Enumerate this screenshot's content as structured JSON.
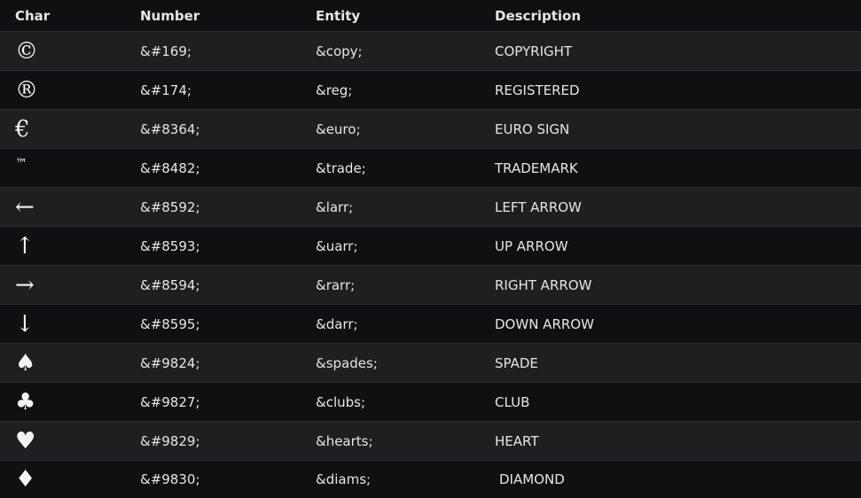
{
  "table": {
    "headers": [
      "Char",
      "Number",
      "Entity",
      "Description"
    ],
    "rows": [
      {
        "char": "©",
        "number": "&#169;",
        "entity": "&copy;",
        "description": "COPYRIGHT"
      },
      {
        "char": "®",
        "number": "&#174;",
        "entity": "&reg;",
        "description": "REGISTERED"
      },
      {
        "char": "€",
        "number": "&#8364;",
        "entity": "&euro;",
        "description": "EURO SIGN"
      },
      {
        "char": "™",
        "number": "&#8482;",
        "entity": "&trade;",
        "description": "TRADEMARK"
      },
      {
        "char": "←",
        "number": "&#8592;",
        "entity": "&larr;",
        "description": "LEFT ARROW"
      },
      {
        "char": "↑",
        "number": "&#8593;",
        "entity": "&uarr;",
        "description": "UP ARROW"
      },
      {
        "char": "→",
        "number": "&#8594;",
        "entity": "&rarr;",
        "description": "RIGHT ARROW"
      },
      {
        "char": "↓",
        "number": "&#8595;",
        "entity": "&darr;",
        "description": "DOWN ARROW"
      },
      {
        "char": "♠",
        "number": "&#9824;",
        "entity": "&spades;",
        "description": "SPADE"
      },
      {
        "char": "♣",
        "number": "&#9827;",
        "entity": "&clubs;",
        "description": "CLUB"
      },
      {
        "char": "♥",
        "number": "&#9829;",
        "entity": "&hearts;",
        "description": "HEART"
      },
      {
        "char": "♦",
        "number": "&#9830;",
        "entity": "&diams;",
        "description": "DIAMOND"
      }
    ]
  }
}
